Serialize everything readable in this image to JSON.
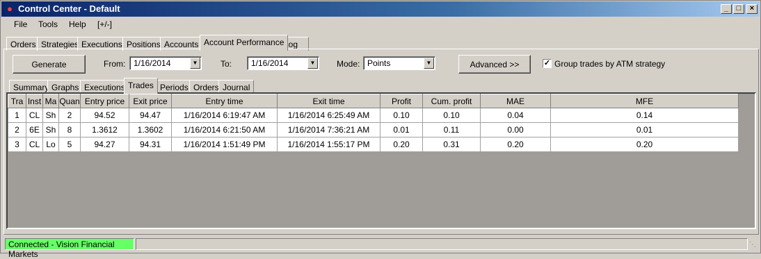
{
  "window": {
    "title": "Control Center - Default",
    "icon": "ninja-logo-icon",
    "controls": {
      "minimize": "_",
      "maximize": "□",
      "close": "×"
    }
  },
  "menu": [
    "File",
    "Tools",
    "Help",
    "[+/-]"
  ],
  "main_tabs": [
    {
      "label": "Orders"
    },
    {
      "label": "Strategies"
    },
    {
      "label": "Executions"
    },
    {
      "label": "Positions"
    },
    {
      "label": "Accounts"
    },
    {
      "label": "Account Performance",
      "active": true
    },
    {
      "label": "Log"
    }
  ],
  "toolbar": {
    "generate_label": "Generate",
    "from_label": "From:",
    "from_value": "1/16/2014",
    "to_label": "To:",
    "to_value": "1/16/2014",
    "mode_label": "Mode:",
    "mode_value": "Points",
    "advanced_label": "Advanced >>",
    "group_trades_label": "Group trades by ATM strategy",
    "group_trades_checked": true
  },
  "sub_tabs": [
    {
      "label": "Summary"
    },
    {
      "label": "Graphs"
    },
    {
      "label": "Executions"
    },
    {
      "label": "Trades",
      "active": true
    },
    {
      "label": "Periods"
    },
    {
      "label": "Orders"
    },
    {
      "label": "Journal"
    }
  ],
  "trades_table": {
    "columns": [
      "Tra",
      "Inst",
      "Ma",
      "Quan",
      "Entry price",
      "Exit price",
      "Entry time",
      "Exit time",
      "Profit",
      "Cum. profit",
      "MAE",
      "MFE"
    ],
    "rows": [
      [
        "1",
        "CL",
        "Sh",
        "2",
        "94.52",
        "94.47",
        "1/16/2014 6:19:47 AM",
        "1/16/2014 6:25:49 AM",
        "0.10",
        "0.10",
        "0.04",
        "0.14"
      ],
      [
        "2",
        "6E",
        "Sh",
        "8",
        "1.3612",
        "1.3602",
        "1/16/2014 6:21:50 AM",
        "1/16/2014 7:36:21 AM",
        "0.01",
        "0.11",
        "0.00",
        "0.01"
      ],
      [
        "3",
        "CL",
        "Lo",
        "5",
        "94.27",
        "94.31",
        "1/16/2014 1:51:49 PM",
        "1/16/2014 1:55:17 PM",
        "0.20",
        "0.31",
        "0.20",
        "0.20"
      ]
    ]
  },
  "status": {
    "connection": "Connected - Vision Financial Markets",
    "connection_color": "#66ff66"
  }
}
